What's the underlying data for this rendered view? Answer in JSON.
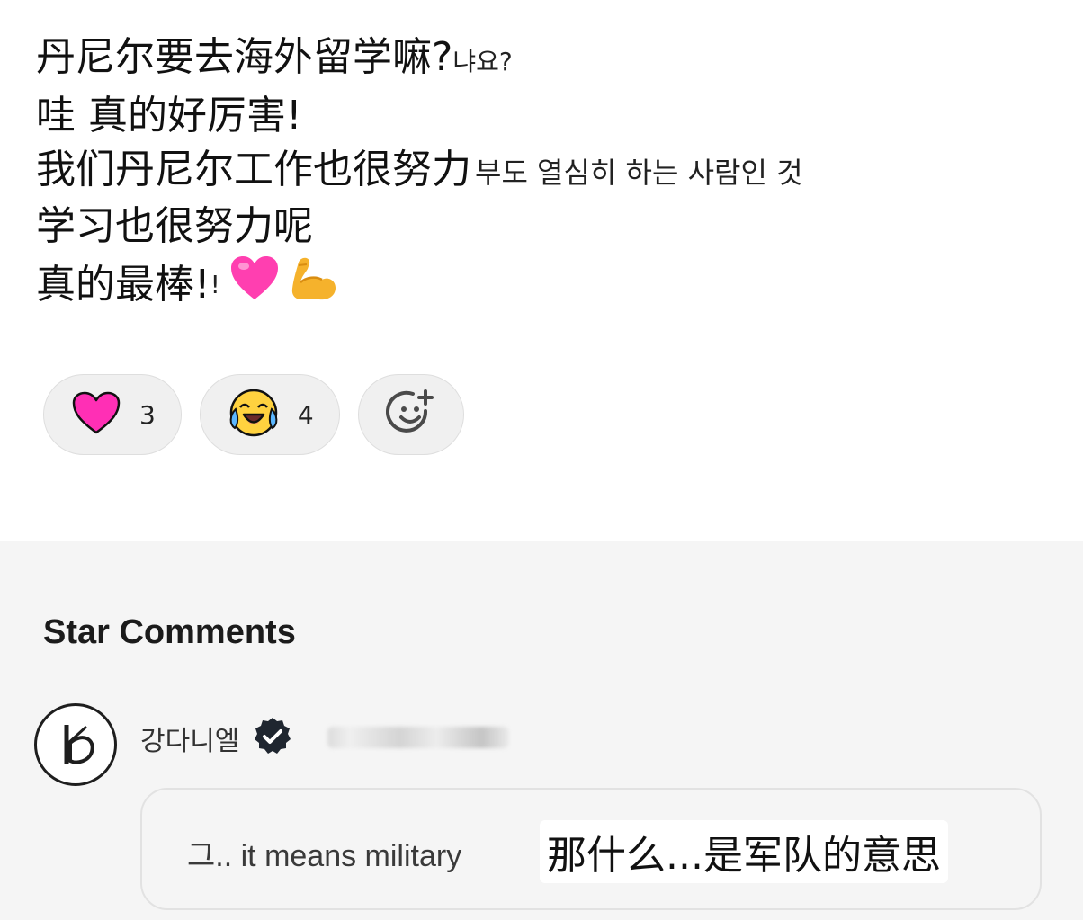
{
  "post": {
    "line1_main": "丹尼尔要去海外留学嘛?",
    "line1_korean": "냐요?",
    "line2": "哇 真的好厉害!",
    "line3_main": "我们丹尼尔工作也很努力",
    "line3_korean": "부도 열심히 하는 사람인 것",
    "line4": "学习也很努力呢",
    "line5_main": "真的最棒!",
    "line5_tail": "!"
  },
  "reactions": [
    {
      "icon": "heart-icon",
      "count": "3"
    },
    {
      "icon": "crying-laughing-face-icon",
      "count": "4"
    },
    {
      "icon": "add-reaction-icon"
    }
  ],
  "comments": {
    "section_title": "Star Comments",
    "author": "강다니엘",
    "comment_text": "그.. it means military",
    "translation_overlay": "那什么...是军队的意思"
  },
  "colors": {
    "heart": "#ff2fb5",
    "comments_bg": "#f5f5f5",
    "verified_badge": "#1f2630"
  }
}
